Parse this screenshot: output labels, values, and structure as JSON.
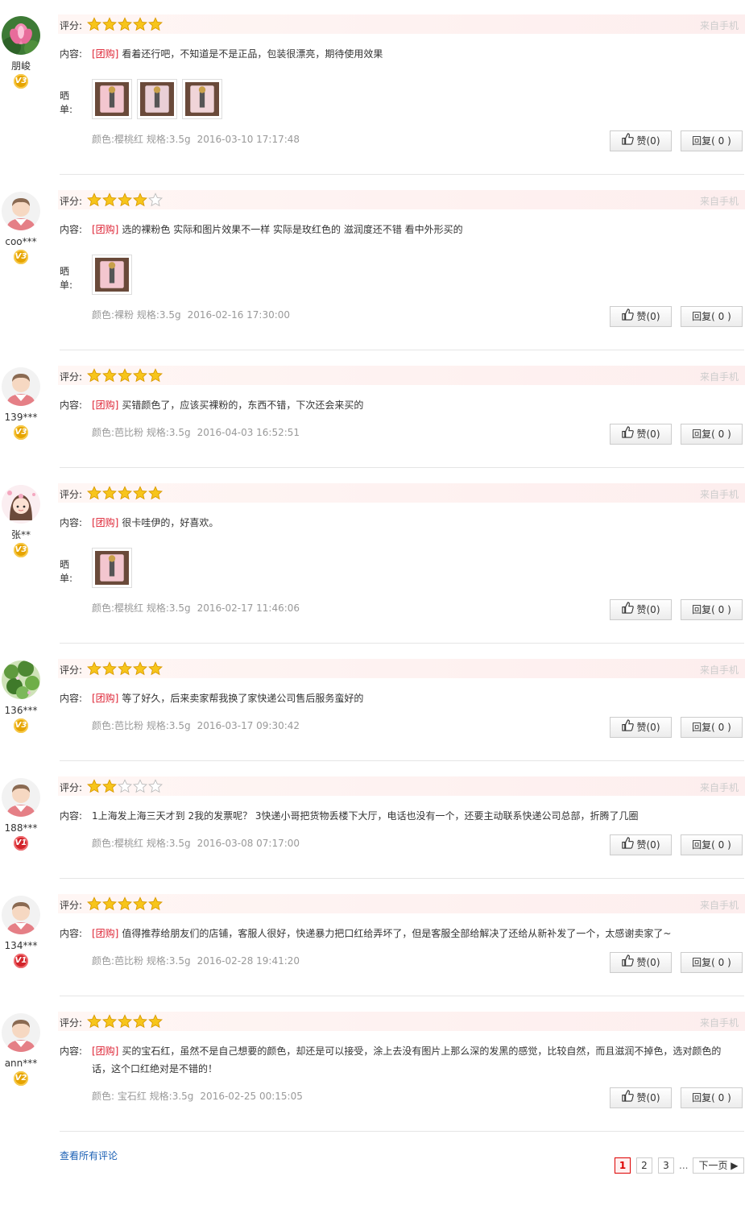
{
  "labels": {
    "rating": "评分:",
    "content": "内容:",
    "photos": "晒单:",
    "from": "来自手机",
    "tag": "[团购]"
  },
  "reviews": [
    {
      "user": "朋峻",
      "level": "V3",
      "level_color": "gold",
      "avatar": "lotus",
      "stars": 5,
      "tagged": true,
      "text": "看着还行吧，不知道是不是正品，包装很漂亮，期待使用效果",
      "photos": 3,
      "attrs": "颜色:樱桃红 规格:3.5g",
      "date": "2016-03-10 17:17:48",
      "likes": "赞(0)",
      "reply": "回复( 0 )"
    },
    {
      "user": "coo***",
      "level": "V3",
      "level_color": "gold",
      "avatar": "default",
      "stars": 4,
      "tagged": true,
      "text": "选的裸粉色 实际和图片效果不一样 实际是玫红色的 滋润度还不错 看中外形买的",
      "photos": 1,
      "attrs": "颜色:裸粉 规格:3.5g",
      "date": "2016-02-16 17:30:00",
      "likes": "赞(0)",
      "reply": "回复( 0 )"
    },
    {
      "user": "139***",
      "level": "V3",
      "level_color": "gold",
      "avatar": "default",
      "stars": 5,
      "tagged": true,
      "text": "买错颜色了，应该买裸粉的，东西不错，下次还会来买的",
      "photos": 0,
      "attrs": "颜色:芭比粉 规格:3.5g",
      "date": "2016-04-03 16:52:51",
      "likes": "赞(0)",
      "reply": "回复( 0 )"
    },
    {
      "user": "张**",
      "level": "V3",
      "level_color": "gold",
      "avatar": "girl",
      "stars": 5,
      "tagged": true,
      "text": "很卡哇伊的，好喜欢。",
      "photos": 1,
      "attrs": "颜色:樱桃红 规格:3.5g",
      "date": "2016-02-17 11:46:06",
      "likes": "赞(0)",
      "reply": "回复( 0 )"
    },
    {
      "user": "136***",
      "level": "V3",
      "level_color": "gold",
      "avatar": "plant",
      "stars": 5,
      "tagged": true,
      "text": "等了好久，后来卖家帮我换了家快递公司售后服务蛮好的",
      "photos": 0,
      "attrs": "颜色:芭比粉 规格:3.5g",
      "date": "2016-03-17 09:30:42",
      "likes": "赞(0)",
      "reply": "回复( 0 )"
    },
    {
      "user": "188***",
      "level": "V1",
      "level_color": "red",
      "avatar": "default",
      "stars": 2,
      "tagged": false,
      "text": "1上海发上海三天才到 2我的发票呢？ 3快递小哥把货物丢楼下大厅，电话也没有一个，还要主动联系快递公司总部，折腾了几圈",
      "photos": 0,
      "attrs": "颜色:樱桃红 规格:3.5g",
      "date": "2016-03-08 07:17:00",
      "likes": "赞(0)",
      "reply": "回复( 0 )"
    },
    {
      "user": "134***",
      "level": "V1",
      "level_color": "red",
      "avatar": "default",
      "stars": 5,
      "tagged": true,
      "text": "值得推荐给朋友们的店铺，客服人很好，快递暴力把口红给弄坏了，但是客服全部给解决了还给从新补发了一个，太感谢卖家了~",
      "photos": 0,
      "attrs": "颜色:芭比粉 规格:3.5g",
      "date": "2016-02-28 19:41:20",
      "likes": "赞(0)",
      "reply": "回复( 0 )"
    },
    {
      "user": "ann***",
      "level": "V2",
      "level_color": "gold",
      "avatar": "default",
      "stars": 5,
      "tagged": true,
      "text": "买的宝石红，虽然不是自己想要的颜色，却还是可以接受，涂上去没有图片上那么深的发黑的感觉，比较自然，而且滋润不掉色，选对颜色的话，这个口红绝对是不错的！",
      "photos": 0,
      "attrs": "颜色: 宝石红 规格:3.5g",
      "date": "2016-02-25 00:15:05",
      "likes": "赞(0)",
      "reply": "回复( 0 )"
    }
  ],
  "footer": {
    "all_reviews": "查看所有评论",
    "pages": [
      "1",
      "2",
      "3"
    ],
    "ellipsis": "...",
    "next": "下一页"
  },
  "colors": {
    "accent_red": "#dd2222",
    "link_blue": "#1a5fb4",
    "star_yellow": "#f7c51b"
  }
}
